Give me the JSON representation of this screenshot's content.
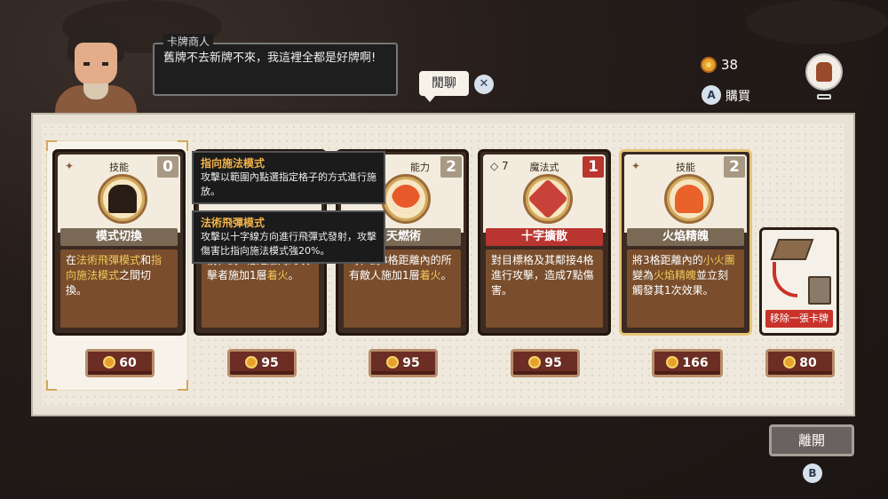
{
  "npc": {
    "name": "卡牌商人",
    "dialog": "舊牌不去新牌不來，我這裡全都是好牌啊!"
  },
  "chat_button": "閒聊",
  "close_hint_glyph": "✕",
  "currency": {
    "amount": "38",
    "icon": "coin-icon"
  },
  "buy": {
    "key": "A",
    "label": "購買"
  },
  "cards": [
    {
      "type": "技能",
      "cost": "0",
      "name": "模式切換",
      "desc": [
        "在",
        {
          "h": "法術飛彈模式"
        },
        "和",
        {
          "h": "指向施法模式"
        },
        "之間切換。"
      ],
      "price": "60",
      "selected": true
    },
    {
      "type": "",
      "cost": "",
      "name": "",
      "desc": [
        "前，對2格距離內的攻擊者施加1層",
        {
          "h": "着火"
        },
        "。"
      ],
      "price": "95"
    },
    {
      "type": "能力",
      "cost": "2",
      "name": "天燃術",
      "desc": [
        "時，對3格距離內的所有敵人施加1層",
        {
          "h": "着火"
        },
        "。"
      ],
      "price": "95"
    },
    {
      "type": "魔法式",
      "cost": "1",
      "durability": "7",
      "name": "十字擴散",
      "desc": [
        "對目標格及其鄰接4格進行攻擊，造成7點傷害。"
      ],
      "price": "95"
    },
    {
      "type": "技能",
      "cost": "2",
      "name": "火焰精魄",
      "desc": [
        "將3格距離內的",
        {
          "h": "小火團"
        },
        "變為",
        {
          "h": "火焰精魄"
        },
        "並立刻觸發其1次效果。"
      ],
      "price": "166"
    }
  ],
  "remove_card": {
    "label": "移除一張卡牌",
    "price": "80"
  },
  "tooltips": [
    {
      "title": "指向施法模式",
      "text": "攻擊以範圍內點選指定格子的方式進行施放。"
    },
    {
      "title": "法術飛彈模式",
      "text": "攻擊以十字線方向進行飛彈式發射，攻擊傷害比指向施法模式強20%。"
    }
  ],
  "leave": {
    "label": "離開",
    "key": "B"
  }
}
